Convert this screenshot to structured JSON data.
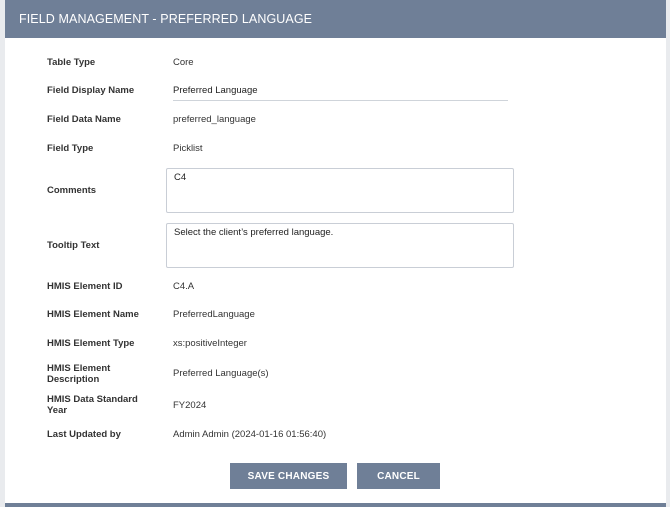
{
  "dialog": {
    "title": "FIELD MANAGEMENT - PREFERRED LANGUAGE"
  },
  "fields": {
    "table_type": {
      "label": "Table Type",
      "value": "Core"
    },
    "field_display_name": {
      "label": "Field Display Name",
      "value": "Preferred Language"
    },
    "field_data_name": {
      "label": "Field Data Name",
      "value": "preferred_language"
    },
    "field_type": {
      "label": "Field Type",
      "value": "Picklist"
    },
    "comments": {
      "label": "Comments",
      "value": "C4"
    },
    "tooltip_text": {
      "label": "Tooltip Text",
      "value": "Select the client’s preferred language."
    },
    "hmis_element_id": {
      "label": "HMIS Element ID",
      "value": "C4.A"
    },
    "hmis_element_name": {
      "label": "HMIS Element Name",
      "value": "PreferredLanguage"
    },
    "hmis_element_type": {
      "label": "HMIS Element Type",
      "value": "xs:positiveInteger"
    },
    "hmis_element_description": {
      "label": "HMIS Element Description",
      "value": "Preferred Language(s)"
    },
    "hmis_data_standard_year": {
      "label": "HMIS Data Standard Year",
      "value": "FY2024"
    },
    "last_updated_by": {
      "label": "Last Updated by",
      "value": "Admin Admin (2024-01-16 01:56:40)"
    }
  },
  "actions": {
    "save_label": "SAVE CHANGES",
    "cancel_label": "CANCEL"
  },
  "colors": {
    "header_bg": "#6f7f97",
    "button_bg": "#6f7f97",
    "page_bg": "#e9ebee"
  }
}
